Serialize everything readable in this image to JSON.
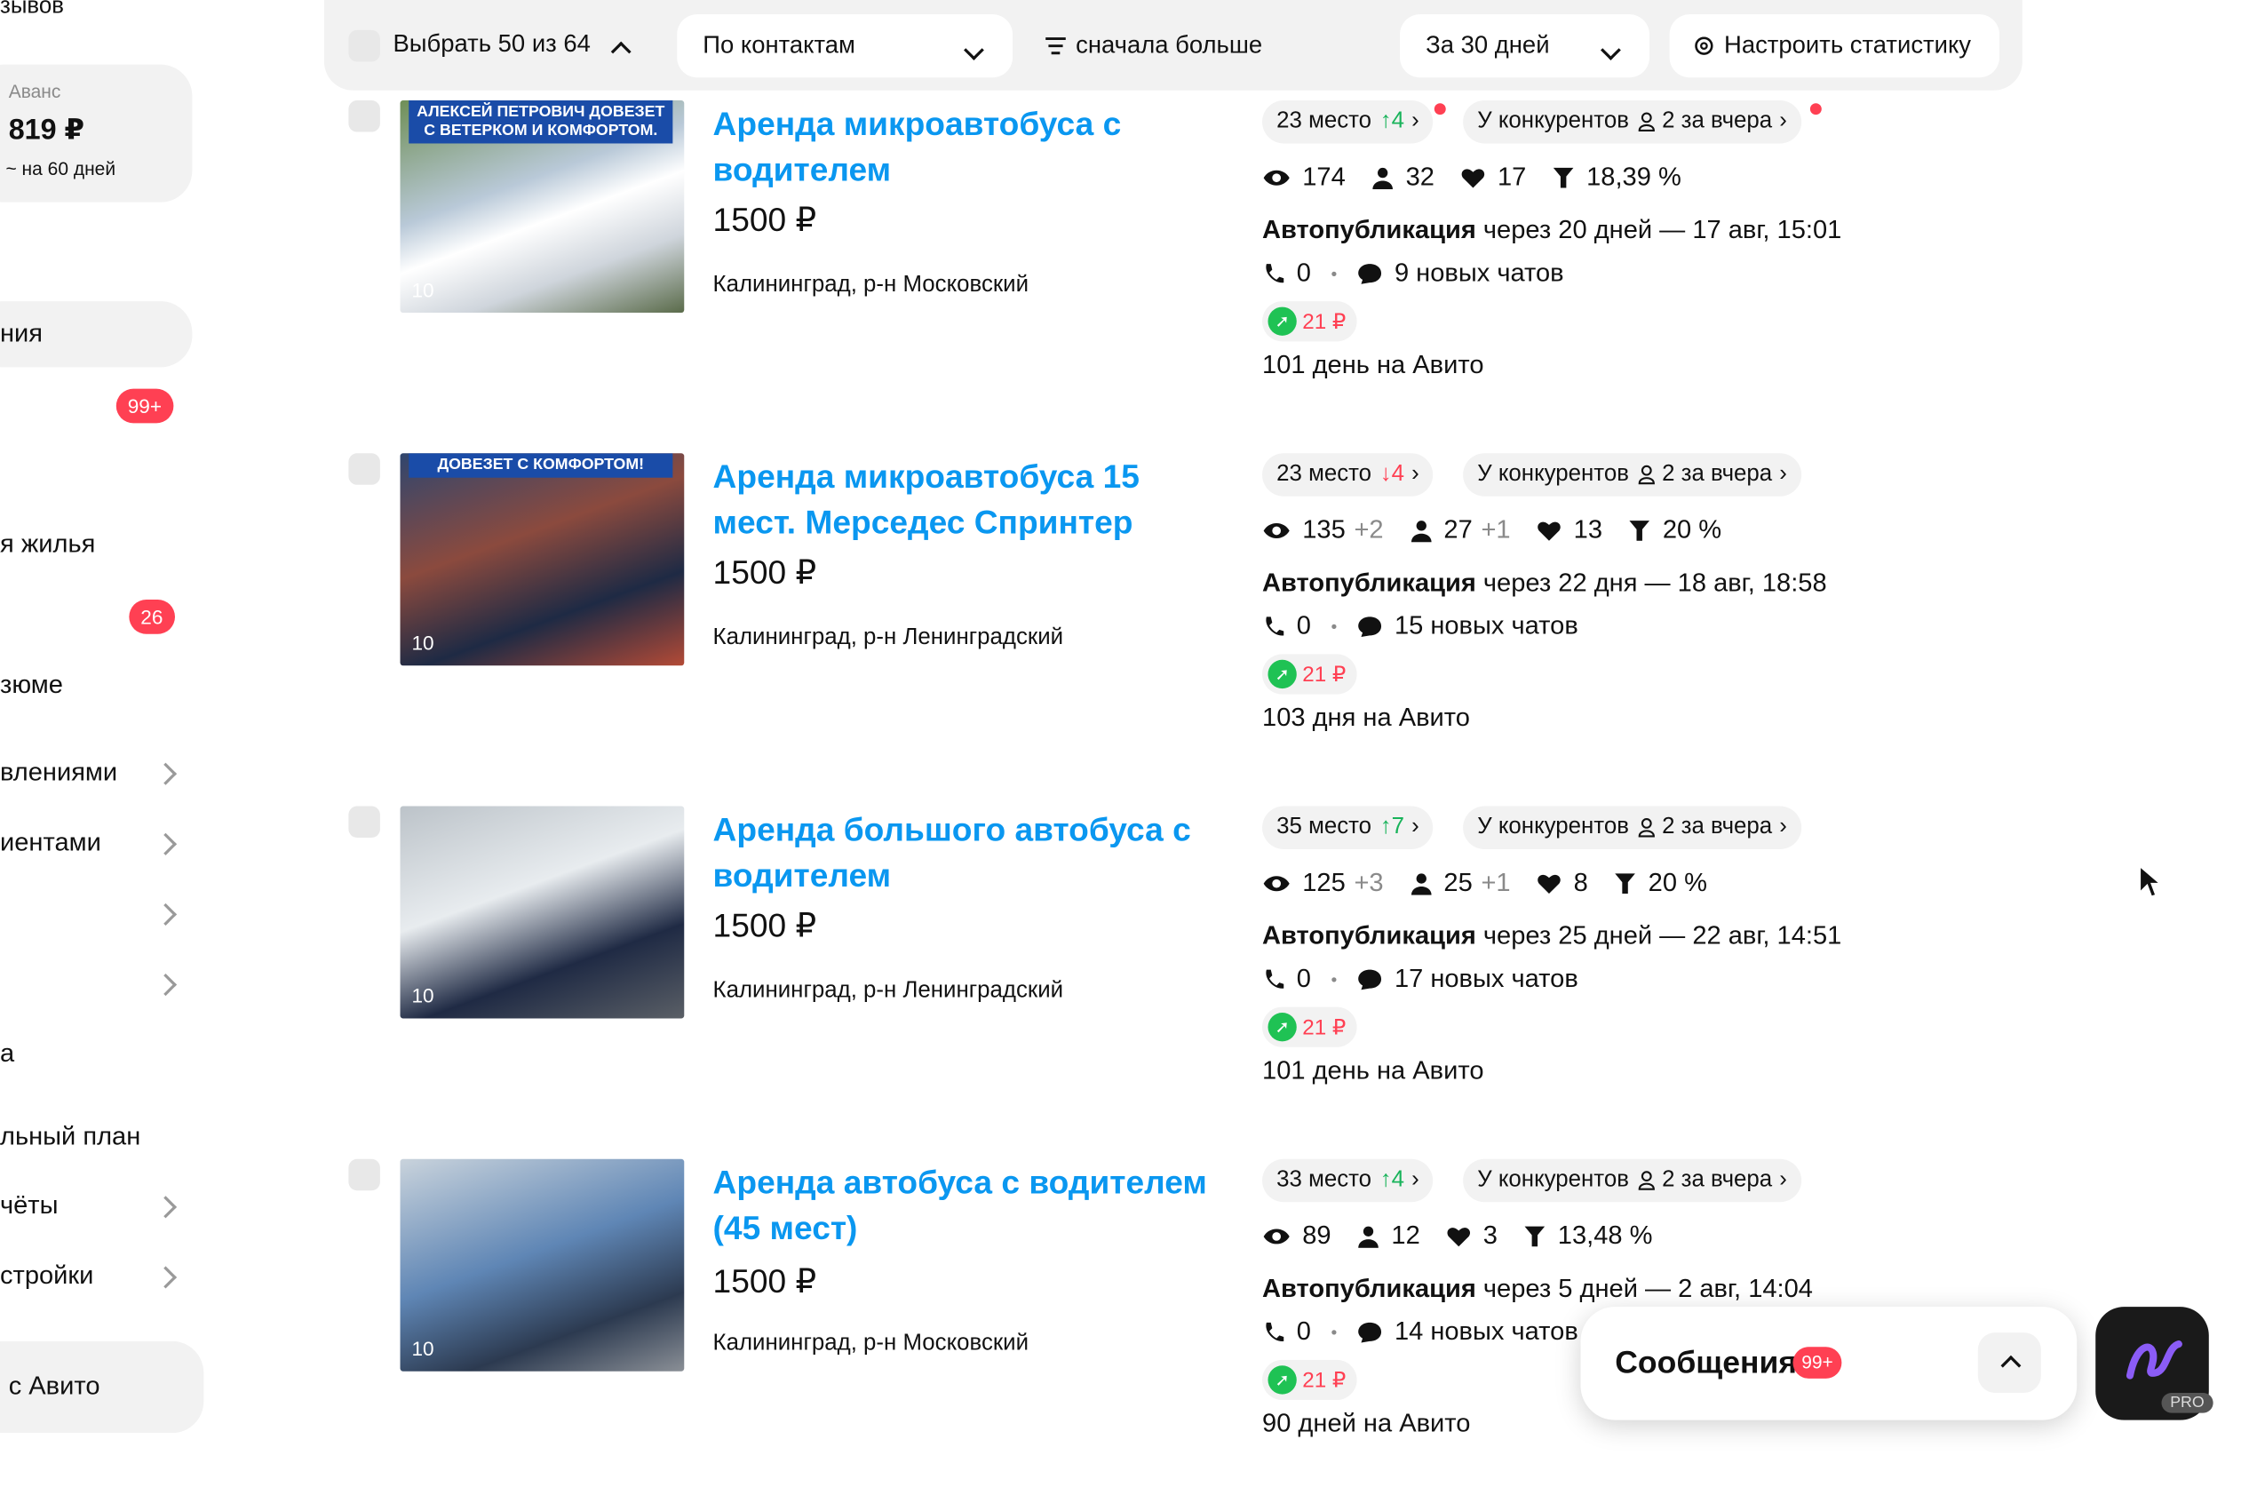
{
  "sidebar": {
    "top_text": "зывов",
    "advance": {
      "label": "Аванс",
      "amount": "819 ₽",
      "days": "~ на 60 дней"
    },
    "items": [
      {
        "label": "ния"
      },
      {
        "label": "",
        "badge": "99+"
      },
      {
        "label": "я жилья"
      },
      {
        "label": "",
        "badge": "26"
      },
      {
        "label": "зюме"
      },
      {
        "label": "влениями"
      },
      {
        "label": "иентами"
      },
      {
        "label": "а"
      },
      {
        "label": "льный план"
      },
      {
        "label": "чёты"
      },
      {
        "label": "стройки"
      },
      {
        "label": "с Авито"
      }
    ]
  },
  "toolbar": {
    "select_label": "Выбрать 50 из 64",
    "sort_by": "По контактам",
    "order": "сначала больше",
    "period": "За 30 дней",
    "configure": "Настроить статистику"
  },
  "listings": [
    {
      "title": "Аренда микроавтобуса с водителем",
      "price": "1500 ₽",
      "location": "Калининград, р-н Московский",
      "photo_count": "10",
      "banner": "АЛЕКСЕЙ ПЕТРОВИЧ ДОВЕЗЕТ С ВЕТЕРКОМ И КОМФОРТОМ.",
      "place": "23 место",
      "place_delta": "↑4",
      "competitors": "У конкурентов",
      "competitors_count": "2 за вчера",
      "views": "174",
      "views_delta": "",
      "contacts": "32",
      "contacts_delta": "",
      "favorites": "17",
      "conversion": "18,39 %",
      "autopub_label": "Автопубликация",
      "autopub_text": "через 20 дней — 17 авг, 15:01",
      "calls": "0",
      "chats": "9 новых чатов",
      "promo": "21 ₽",
      "days": "101 день на Авито"
    },
    {
      "title": "Аренда микроавтобуса 15 мест. Мерседес Спринтер",
      "price": "1500 ₽",
      "location": "Калининград, р-н Ленинградский",
      "photo_count": "10",
      "banner": "ДОВЕЗЕТ С КОМФОРТОМ!",
      "place": "23 место",
      "place_delta": "↓4",
      "competitors": "У конкурентов",
      "competitors_count": "2 за вчера",
      "views": "135",
      "views_delta": "+2",
      "contacts": "27",
      "contacts_delta": "+1",
      "favorites": "13",
      "conversion": "20 %",
      "autopub_label": "Автопубликация",
      "autopub_text": "через 22 дня — 18 авг, 18:58",
      "calls": "0",
      "chats": "15 новых чатов",
      "promo": "21 ₽",
      "days": "103 дня на Авито"
    },
    {
      "title": "Аренда большого автобуса с водителем",
      "price": "1500 ₽",
      "location": "Калининград, р-н Ленинградский",
      "photo_count": "10",
      "banner": "",
      "place": "35 место",
      "place_delta": "↑7",
      "competitors": "У конкурентов",
      "competitors_count": "2 за вчера",
      "views": "125",
      "views_delta": "+3",
      "contacts": "25",
      "contacts_delta": "+1",
      "favorites": "8",
      "conversion": "20 %",
      "autopub_label": "Автопубликация",
      "autopub_text": "через 25 дней — 22 авг, 14:51",
      "calls": "0",
      "chats": "17 новых чатов",
      "promo": "21 ₽",
      "days": "101 день на Авито"
    },
    {
      "title": "Аренда автобуса с водителем (45 мест)",
      "price": "1500 ₽",
      "location": "Калининград, р-н Московский",
      "photo_count": "10",
      "banner": "",
      "place": "33 место",
      "place_delta": "↑4",
      "competitors": "У конкурентов",
      "competitors_count": "2 за вчера",
      "views": "89",
      "views_delta": "",
      "contacts": "12",
      "contacts_delta": "",
      "favorites": "3",
      "conversion": "13,48 %",
      "autopub_label": "Автопубликация",
      "autopub_text": "через 5 дней — 2 авг, 14:04",
      "calls": "0",
      "chats": "14 новых чатов",
      "promo": "21 ₽",
      "days": "90 дней на Авито"
    }
  ],
  "messages": {
    "label": "Сообщения",
    "badge": "99+"
  },
  "pro_badge": "PRO"
}
